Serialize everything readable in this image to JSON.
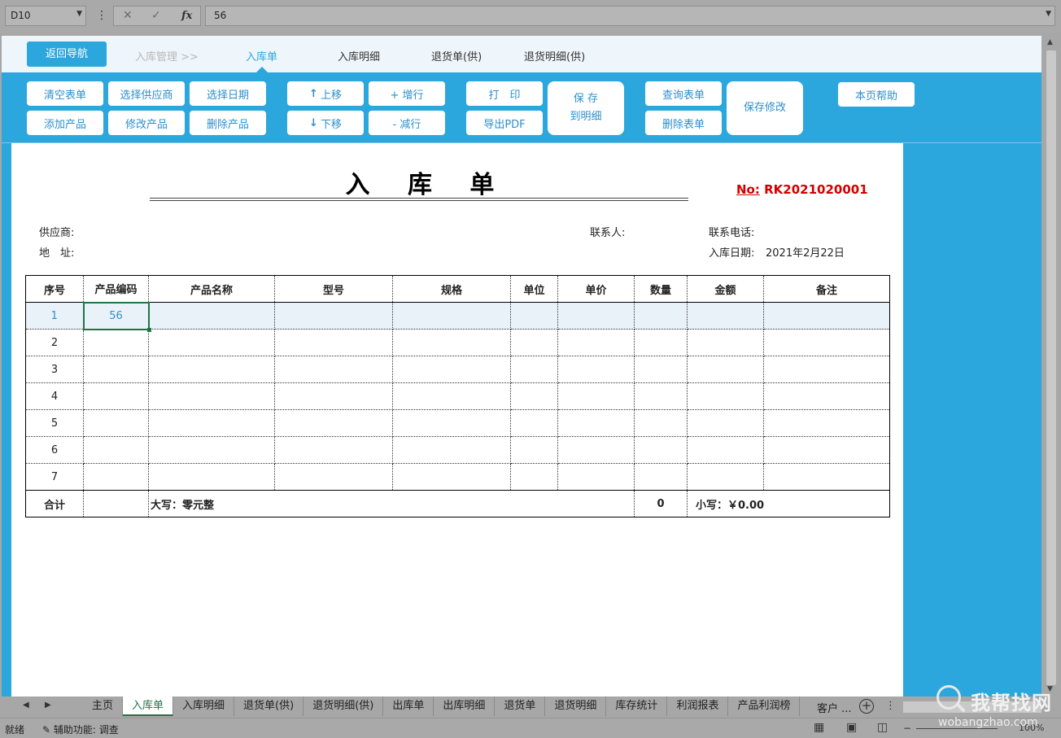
{
  "formula_bar": {
    "name_box": "D10",
    "formula": "56"
  },
  "nav": {
    "back_label": "返回导航",
    "crumb": "入库管理 >>",
    "tabs": [
      {
        "label": "入库单",
        "active": true
      },
      {
        "label": "入库明细",
        "active": false
      },
      {
        "label": "退货单(供)",
        "active": false
      },
      {
        "label": "退货明细(供)",
        "active": false
      }
    ]
  },
  "toolbar": {
    "clear_form": "清空表单",
    "select_supplier": "选择供应商",
    "select_date": "选择日期",
    "add_product": "添加产品",
    "edit_product": "修改产品",
    "delete_product": "删除产品",
    "move_up": "上移",
    "move_down": "下移",
    "add_row": "+ 增行",
    "remove_row": "- 减行",
    "print": "打　印",
    "export_pdf": "导出PDF",
    "save_line1": "保 存",
    "save_line2": "到明细",
    "query_form": "查询表单",
    "delete_form": "删除表单",
    "save_changes": "保存修改",
    "page_help": "本页帮助"
  },
  "document": {
    "title": "入 库 单",
    "no_label": "No:",
    "no_value": "RK2021020001",
    "supplier_label": "供应商:",
    "contact_label": "联系人:",
    "phone_label": "联系电话:",
    "address_label": "地　址:",
    "date_label": "入库日期:",
    "date_value": "2021年2月22日"
  },
  "table": {
    "headers": [
      "序号",
      "产品编码",
      "产品名称",
      "型号",
      "规格",
      "单位",
      "单价",
      "数量",
      "金额",
      "备注"
    ],
    "rows": [
      {
        "seq": "1",
        "code": "56"
      },
      {
        "seq": "2",
        "code": ""
      },
      {
        "seq": "3",
        "code": ""
      },
      {
        "seq": "4",
        "code": ""
      },
      {
        "seq": "5",
        "code": ""
      },
      {
        "seq": "6",
        "code": ""
      },
      {
        "seq": "7",
        "code": ""
      }
    ],
    "total_label": "合计",
    "amount_words": "大写：零元整",
    "total_qty": "0",
    "amount_small": "小写：￥0.00"
  },
  "sheet_tabs": [
    "主页",
    "入库单",
    "入库明细",
    "退货单(供)",
    "退货明细(供)",
    "出库单",
    "出库明细",
    "退货单",
    "退货明细",
    "库存统计",
    "利润报表",
    "产品利润榜",
    "客户 ..."
  ],
  "active_sheet": "入库单",
  "status_bar": {
    "ready": "就绪",
    "accessibility": "辅助功能: 调查",
    "zoom": "100%"
  },
  "watermark": {
    "big": "我帮找网",
    "url": "wobangzhao.com"
  },
  "colors": {
    "accent": "#2ba7dd",
    "doc_no": "#d10000",
    "selection": "#217346"
  }
}
